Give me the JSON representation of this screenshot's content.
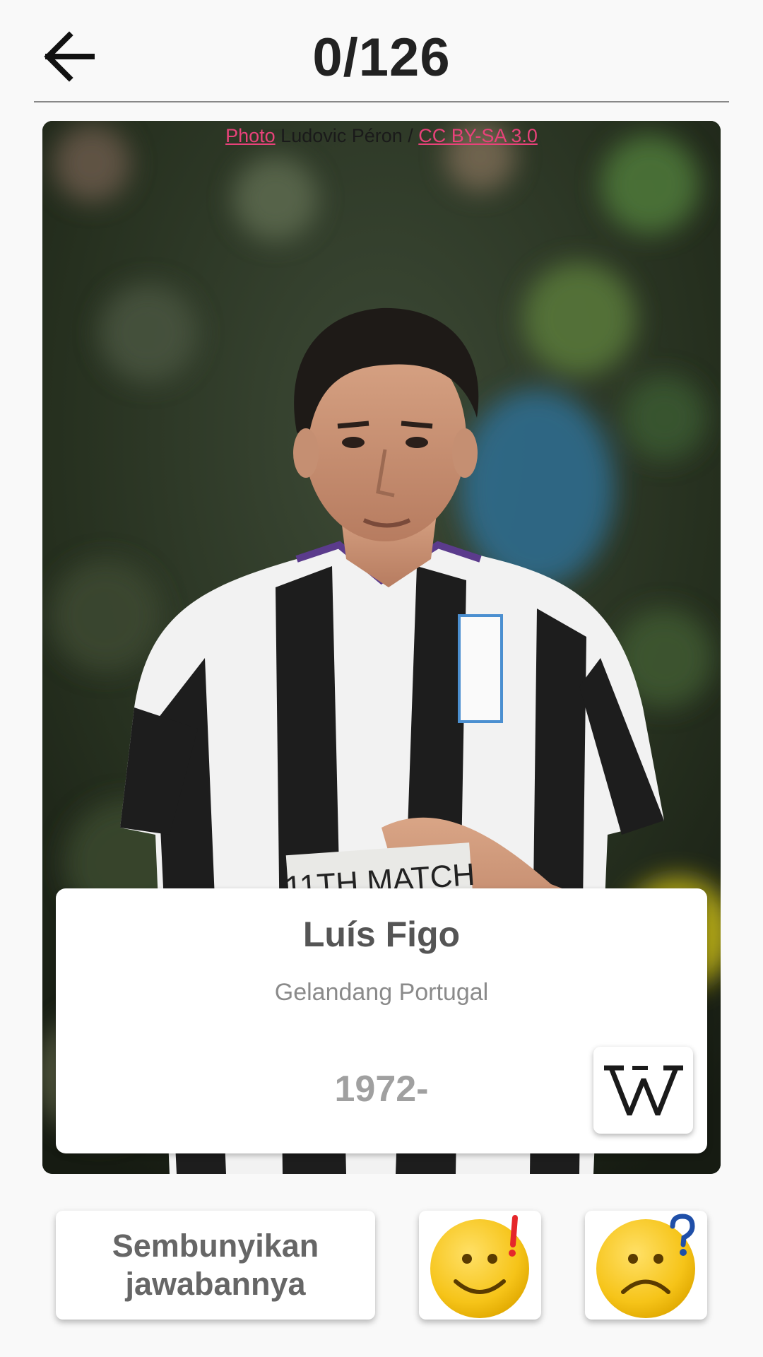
{
  "header": {
    "progress_label": "0/126",
    "back_icon": "arrow-left-icon"
  },
  "photo": {
    "credit_link_label": "Photo",
    "credit_author": " Ludovic Péron / ",
    "credit_license": "CC BY-SA 3.0",
    "link_color": "#e8427a"
  },
  "card": {
    "name": "Luís Figo",
    "description": "Gelandang Portugal",
    "years": "1972-",
    "wiki_icon": "wikipedia-icon"
  },
  "actions": {
    "hide_label_line1": "Sembunyikan",
    "hide_label_line2": "jawabannya",
    "know_icon": "smiley-exclamation-icon",
    "dont_know_icon": "sad-question-icon"
  }
}
